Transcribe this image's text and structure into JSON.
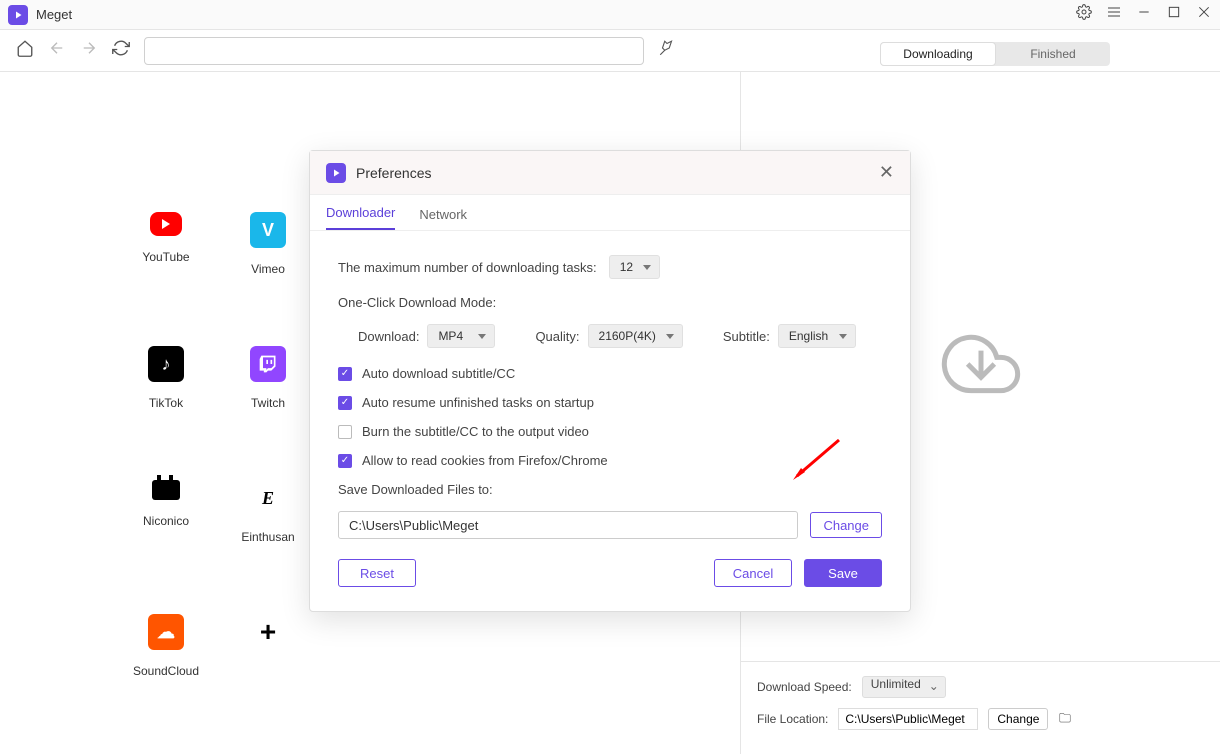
{
  "app": {
    "name": "Meget"
  },
  "toolbar": {
    "url_value": ""
  },
  "rightTabs": {
    "downloading": "Downloading",
    "finished": "Finished"
  },
  "sites": [
    {
      "label": "YouTube"
    },
    {
      "label": "Vimeo"
    },
    {
      "label": "TikTok"
    },
    {
      "label": "Twitch"
    },
    {
      "label": "Niconico"
    },
    {
      "label": "Einthusan"
    },
    {
      "label": "SoundCloud"
    }
  ],
  "rightFooter": {
    "speedLabel": "Download Speed:",
    "speedValue": "Unlimited",
    "locationLabel": "File Location:",
    "locationValue": "C:\\Users\\Public\\Meget",
    "changeLabel": "Change"
  },
  "dialog": {
    "title": "Preferences",
    "tabs": {
      "downloader": "Downloader",
      "network": "Network"
    },
    "maxTasksLabel": "The maximum number of downloading tasks:",
    "maxTasksValue": "12",
    "oneClickLabel": "One-Click Download Mode:",
    "downloadLabel": "Download:",
    "downloadValue": "MP4",
    "qualityLabel": "Quality:",
    "qualityValue": "2160P(4K)",
    "subtitleLabel": "Subtitle:",
    "subtitleValue": "English",
    "check1": "Auto download subtitle/CC",
    "check2": "Auto resume unfinished tasks on startup",
    "check3": "Burn the subtitle/CC to the output video",
    "check4": "Allow to read cookies from Firefox/Chrome",
    "savePathLabel": "Save Downloaded Files to:",
    "savePathValue": "C:\\Users\\Public\\Meget",
    "changeLabel": "Change",
    "resetLabel": "Reset",
    "cancelLabel": "Cancel",
    "saveLabel": "Save"
  }
}
